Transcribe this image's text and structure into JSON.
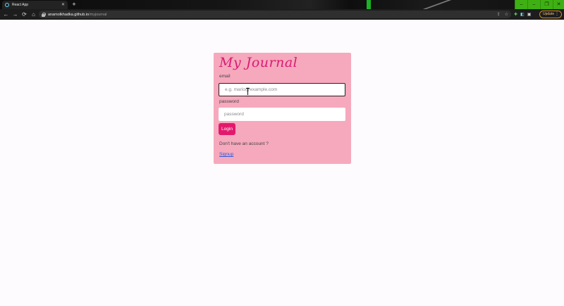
{
  "browser": {
    "tab_title": "React App",
    "url_host": "anamolkhadka.github.io",
    "url_path": "/myjournal",
    "update_label": "Update",
    "nav_icons": {
      "back": "←",
      "forward": "→",
      "reload": "⟳",
      "home": "⌂"
    },
    "omnibox_icons": {
      "share": "⇪",
      "bookmark": "☆"
    },
    "extension_icons": [
      "✚",
      "◧",
      "▣"
    ],
    "window_controls": {
      "minimize": "–",
      "restore": "❐",
      "close": "✕"
    },
    "colors": {
      "window_controls": "#3fb014",
      "update_border": "#c98a2a"
    }
  },
  "journal": {
    "title": "My Journal",
    "email_label": "email",
    "email_placeholder": "e.g. mario@example.com",
    "password_label": "password",
    "password_placeholder": "password",
    "login_label": "Login",
    "no_account_text": "Don't have an account ?",
    "signup_label": "Signup",
    "colors": {
      "card": "#f6a8bd",
      "title": "#d81b74",
      "button": "#e3186d",
      "page": "#fdfbfd"
    }
  }
}
